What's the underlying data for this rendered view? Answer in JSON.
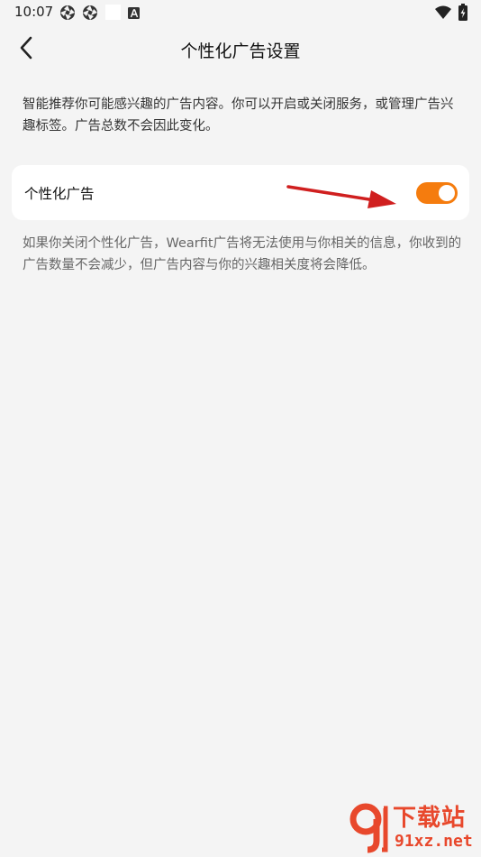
{
  "status_bar": {
    "time": "10:07",
    "icons": [
      "aperture-icon",
      "aperture-icon",
      "blank-square-icon",
      "a-badge-icon",
      "wifi-icon",
      "battery-charging-icon"
    ]
  },
  "header": {
    "title": "个性化广告设置",
    "back_icon": "chevron-left-icon"
  },
  "intro": "智能推荐你可能感兴趣的广告内容。你可以开启或关闭服务，或管理广告兴趣标签。广告总数不会因此变化。",
  "setting": {
    "label": "个性化广告",
    "enabled": true
  },
  "footnote": "如果你关闭个性化广告，Wearfit广告将无法使用与你相关的信息，你收到的广告数量不会减少，但广告内容与你的兴趣相关度将会降低。",
  "watermark": {
    "brand": "下载站",
    "domain": "91xz.net"
  },
  "colors": {
    "background": "#f4f4f4",
    "card": "#ffffff",
    "toggle_on": "#f57c0e",
    "annotation_arrow": "#d01f1f",
    "watermark": "#e8482c"
  }
}
